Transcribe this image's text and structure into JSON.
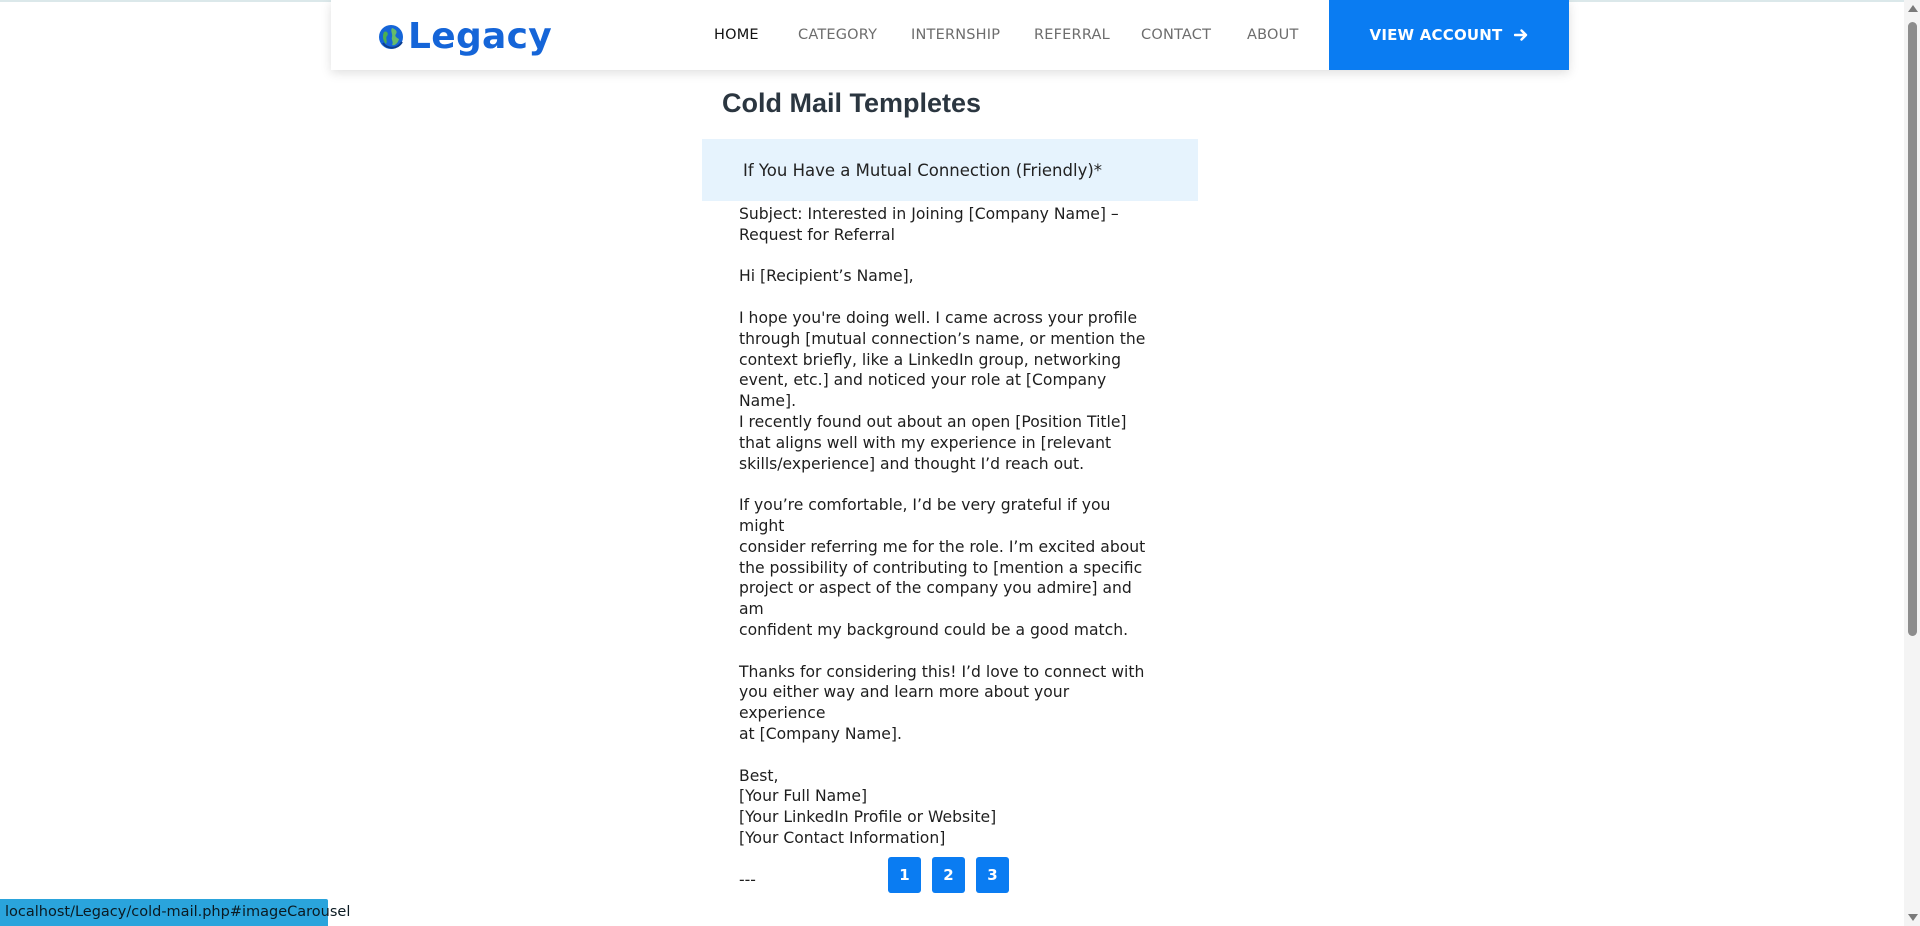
{
  "header": {
    "logo_text": "Legacy",
    "nav": [
      {
        "label": "HOME",
        "active": true
      },
      {
        "label": "CATEGORY",
        "active": false
      },
      {
        "label": "INTERNSHIP",
        "active": false
      },
      {
        "label": "REFERRAL",
        "active": false
      },
      {
        "label": "CONTACT",
        "active": false
      },
      {
        "label": "ABOUT",
        "active": false
      }
    ],
    "view_account_label": "VIEW ACCOUNT",
    "accent_color": "#0a7cf2"
  },
  "main": {
    "title": "Cold Mail Templetes",
    "template": {
      "heading": "If You Have a Mutual Connection (Friendly)*",
      "subject": "Subject: Interested in Joining [Company Name] –\nRequest for Referral",
      "greeting": "Hi [Recipient’s Name],",
      "para1": "I hope you're doing well. I came across your profile\nthrough [mutual connection’s name, or mention the\ncontext briefly, like a LinkedIn group, networking\nevent, etc.] and noticed your role at [Company Name].\nI recently found out about an open [Position Title]\nthat aligns well with my experience in [relevant\nskills/experience] and thought I’d reach out.",
      "para2": "If you’re comfortable, I’d be very grateful if you might\nconsider referring me for the role. I’m excited about\nthe possibility of contributing to [mention a specific\nproject or aspect of the company you admire] and am\nconfident my background could be a good match.",
      "para3": "Thanks for considering this! I’d love to connect with\nyou either way and learn more about your experience\nat [Company Name].",
      "signoff": "Best,\n[Your Full Name]\n[Your LinkedIn Profile or Website]\n[Your Contact Information]",
      "separator": "---"
    },
    "pagination": [
      "1",
      "2",
      "3"
    ]
  },
  "status_bar": {
    "url": "localhost/Legacy/cold-mail.php#imageCarousel"
  }
}
